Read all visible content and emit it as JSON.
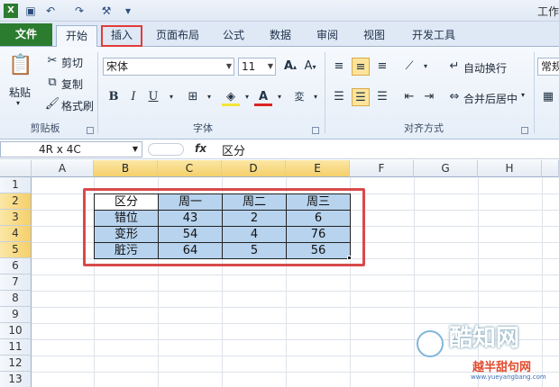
{
  "qat": {
    "title": "工作"
  },
  "tabs": [
    {
      "label": "文件"
    },
    {
      "label": "开始"
    },
    {
      "label": "插入"
    },
    {
      "label": "页面布局"
    },
    {
      "label": "公式"
    },
    {
      "label": "数据"
    },
    {
      "label": "审阅"
    },
    {
      "label": "视图"
    },
    {
      "label": "开发工具"
    }
  ],
  "clipboard": {
    "paste": "粘贴",
    "cut": "剪切",
    "copy": "复制",
    "format_painter": "格式刷",
    "group": "剪贴板"
  },
  "font": {
    "name": "宋体",
    "size": "11",
    "bold": "B",
    "italic": "I",
    "underline": "U",
    "group": "字体"
  },
  "alignment": {
    "wrap": "自动换行",
    "merge": "合并后居中",
    "group": "对齐方式"
  },
  "number": {
    "format": "常规"
  },
  "formula": {
    "namebox": "4R x 4C",
    "fx": "fx",
    "value": "区分"
  },
  "columns": [
    "A",
    "B",
    "C",
    "D",
    "E",
    "F",
    "G",
    "H"
  ],
  "rows": [
    "1",
    "2",
    "3",
    "4",
    "5",
    "6",
    "7",
    "8",
    "9",
    "10",
    "11",
    "12",
    "13"
  ],
  "table": {
    "header": [
      "区分",
      "周一",
      "周二",
      "周三"
    ],
    "rows": [
      [
        "错位",
        "43",
        "2",
        "6"
      ],
      [
        "变形",
        "54",
        "4",
        "76"
      ],
      [
        "脏污",
        "64",
        "5",
        "56"
      ]
    ]
  },
  "watermark": {
    "brand": "酷知网",
    "sub": "越半甜句网",
    "url": "www.yueyangbang.com"
  }
}
